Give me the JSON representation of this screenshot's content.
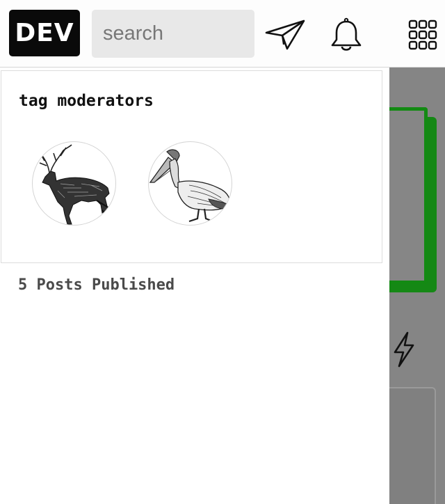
{
  "header": {
    "logo_text": "DEV",
    "search": {
      "placeholder": "search",
      "value": ""
    },
    "icons": [
      "paper-plane-icon",
      "bell-icon",
      "apps-grid-icon"
    ]
  },
  "sidebar": {
    "tag_moderators": {
      "title": "tag moderators",
      "moderators": [
        {
          "avatar": "deer-engraving-avatar"
        },
        {
          "avatar": "pelican-engraving-avatar"
        }
      ]
    },
    "stats": {
      "posts_published": "5 Posts Published"
    }
  },
  "colors": {
    "logo_bg": "#0a0a0a",
    "search_bg": "#e8e8e8",
    "accent_green": "#138a13",
    "overlay_gray": "#858585"
  }
}
